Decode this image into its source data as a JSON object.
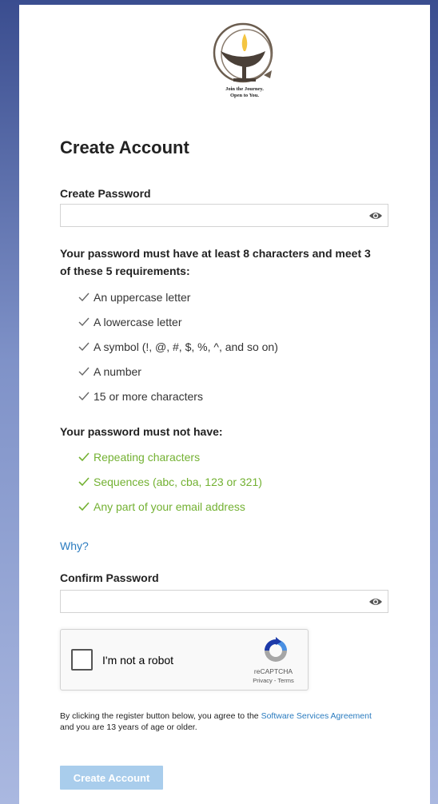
{
  "logo": {
    "caption_line1": "Join the Journey.",
    "caption_line2": "Open to You."
  },
  "page_title": "Create Account",
  "create_password": {
    "label": "Create Password",
    "value": "",
    "placeholder": "",
    "toggle_icon": "eye-icon"
  },
  "requirements": {
    "heading": "Your password must have at least 8 characters and meet 3 of these 5 requirements:",
    "items": [
      "An uppercase letter",
      "A lowercase letter",
      "A symbol (!, @, #, $, %, ^, and so on)",
      "A number",
      "15 or more characters"
    ]
  },
  "restrictions": {
    "heading": "Your password must not have:",
    "items": [
      "Repeating characters",
      "Sequences (abc, cba, 123 or 321)",
      "Any part of your email address"
    ]
  },
  "why_link": "Why?",
  "confirm_password": {
    "label": "Confirm Password",
    "value": "",
    "placeholder": "",
    "toggle_icon": "eye-icon"
  },
  "recaptcha": {
    "label": "I'm not a robot",
    "brand": "reCAPTCHA",
    "privacy": "Privacy",
    "separator": " - ",
    "terms": "Terms"
  },
  "agreement": {
    "text_before": "By clicking the register button below, you agree to the ",
    "link": "Software Services Agreement",
    "text_after": " and you are 13 years of age or older."
  },
  "submit_label": "Create Account",
  "colors": {
    "met_green": "#73b132",
    "link_blue": "#2a7bbf",
    "button_disabled": "#a9cdec"
  }
}
